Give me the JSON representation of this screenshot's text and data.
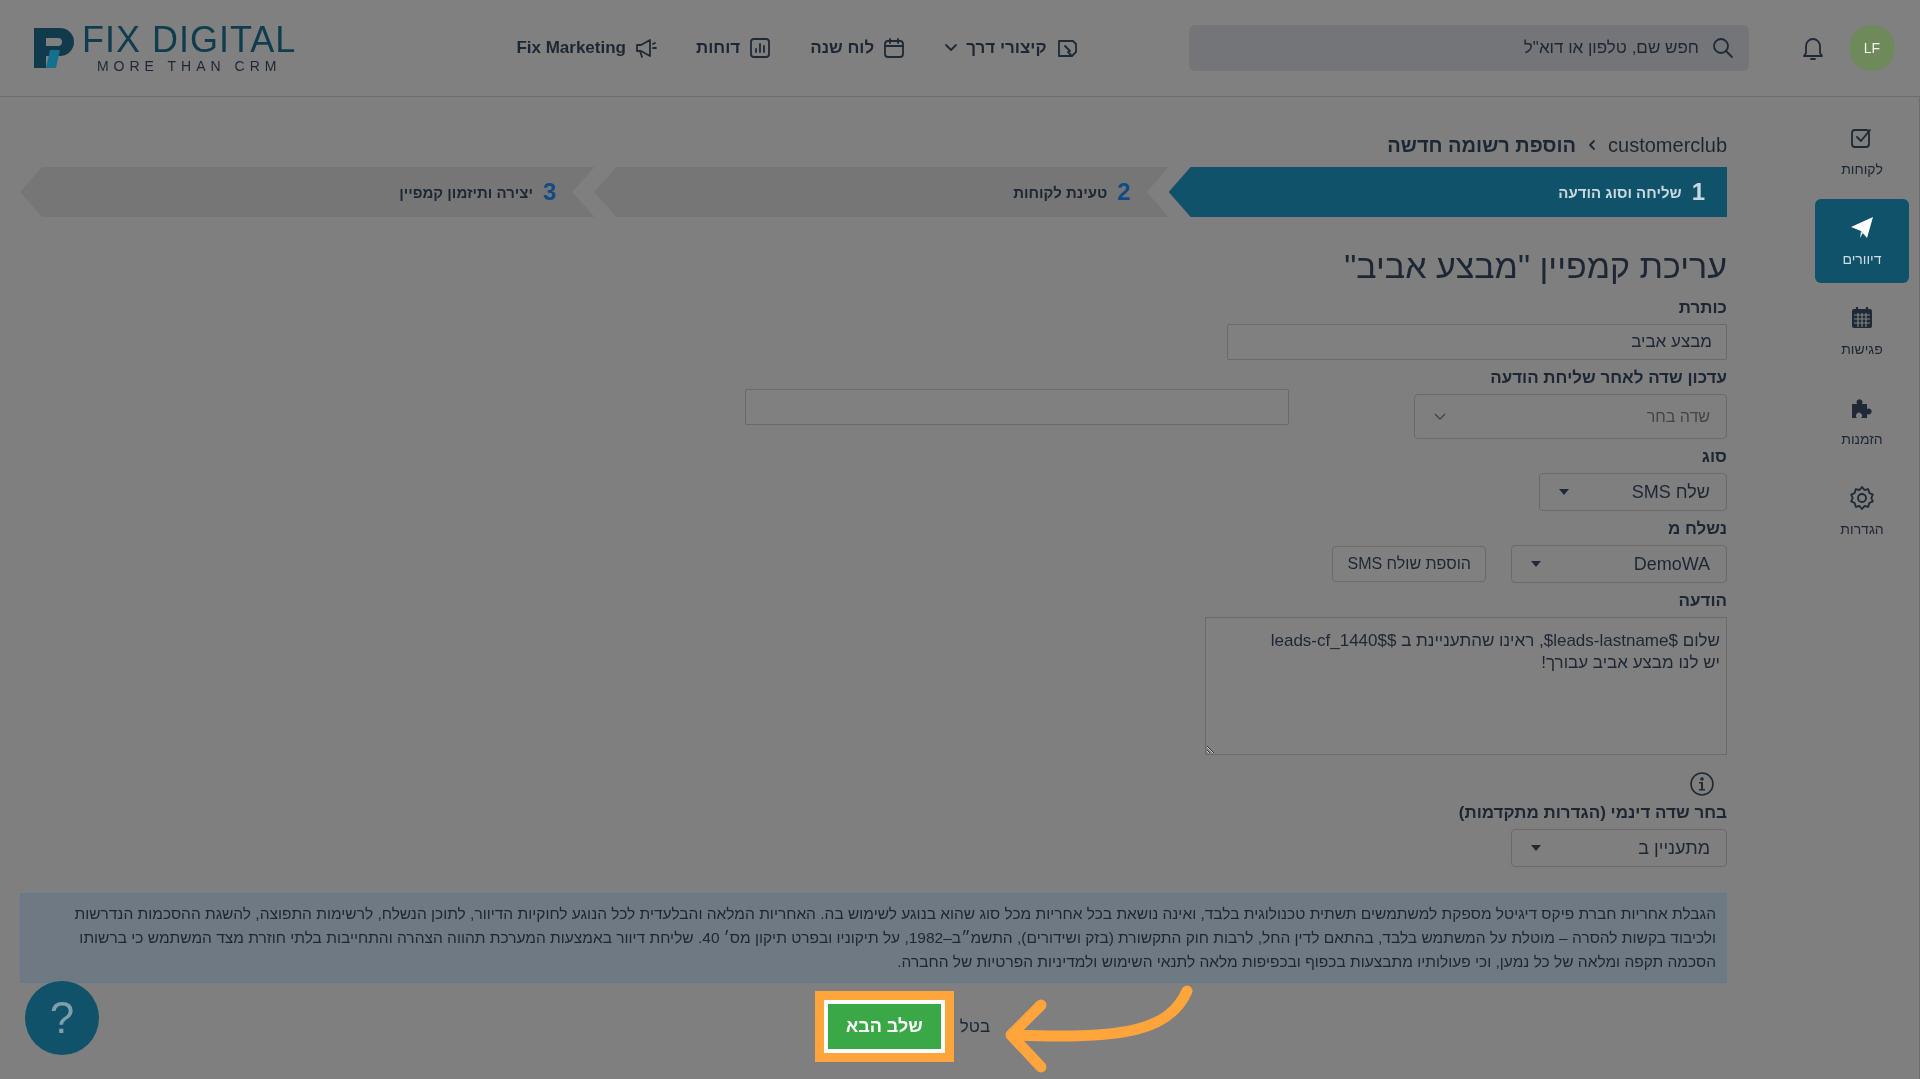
{
  "header": {
    "logo": {
      "title": "FIX DIGITAL",
      "tagline": "MORE THAN CRM"
    },
    "nav": [
      {
        "label": "קיצורי דרך",
        "dropdown": true
      },
      {
        "label": "לוח שנה",
        "dropdown": false
      },
      {
        "label": "דוחות",
        "dropdown": false
      },
      {
        "label": "Fix Marketing",
        "dropdown": false
      }
    ],
    "search": {
      "placeholder": "חפש שם, טלפון או דוא\"ל"
    },
    "avatar": "LF"
  },
  "sidebar": {
    "items": [
      {
        "label": "לקוחות",
        "selected": false
      },
      {
        "label": "דיוורים",
        "selected": true
      },
      {
        "label": "פגישות",
        "selected": false
      },
      {
        "label": "הזמנות",
        "selected": false
      },
      {
        "label": "הגדרות",
        "selected": false
      }
    ]
  },
  "breadcrumb": [
    "customerclub",
    "הוספת רשומה חדשה"
  ],
  "steps": [
    {
      "number": "1",
      "label": "שליחה וסוג הודעה",
      "selected": true
    },
    {
      "number": "2",
      "label": "טעינת לקוחות",
      "selected": false
    },
    {
      "number": "3",
      "label": "יצירה ותיזמון קמפיין",
      "selected": false
    }
  ],
  "form": {
    "heading": "עריכת קמפיין \"מבצע אביב\"",
    "title_field": {
      "label": "כותרת",
      "value": "מבצע אביב"
    },
    "update_field": {
      "label": "עדכון שדה לאחר שליחת הודעה",
      "placeholder": "שדה בחר"
    },
    "type_field": {
      "label": "סוג",
      "value": "שלח SMS"
    },
    "sender_field": {
      "label": "נשלח מ",
      "value": "DemoWA",
      "add_button": "הוספת שולח SMS"
    },
    "message_field": {
      "label": "הודעה",
      "value": "שלום $leads-lastname$, ראינו שהתעניינת ב $$leads-cf_1440\nיש לנו מבצע אביב עבורך!"
    },
    "dynamic_field": {
      "label": "בחר שדה דינמי (הגדרות מתקדמות)",
      "value": "מתעניין ב"
    }
  },
  "disclaimer": "הגבלת אחריות חברת פיקס דיגיטל מספקת למשתמשים תשתית טכנולוגית בלבד, ואינה נושאת בכל אחריות מכל סוג שהוא בנוגע לשימוש בה. האחריות המלאה והבלעדית לכל הנוגע לחוקיות הדיוור, לתוכן הנשלח, לרשימות התפוצה, להשגת ההסכמות הנדרשות ולכיבוד בקשות להסרה – מוטלת על המשתמש בלבד, בהתאם לדין החל, לרבות חוק התקשורת (בזק ושידורים), התשמ״ב–1982, על תיקוניו ובפרט תיקון מס׳ 40. שליחת דיוור באמצעות המערכת תהווה הצהרה והתחייבות בלתי חוזרת מצד המשתמש כי ברשותו הסכמה תקפה ומלאה של כל נמען, וכי פעולותיו מתבצעות בכפוף ובכפיפות מלאה לתנאי השימוש ולמדיניות הפרטיות של החברה.",
  "actions": {
    "next": "שלב הבא",
    "cancel": "בטל"
  },
  "help": "?"
}
